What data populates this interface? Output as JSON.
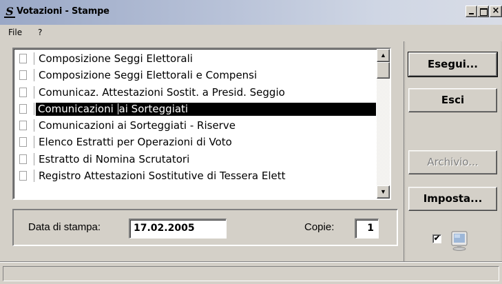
{
  "window": {
    "title": "Votazioni - Stampe",
    "icon": "S-app-icon",
    "controls": {
      "minimize": "_",
      "maximize": "□",
      "close": "×"
    }
  },
  "menu": [
    {
      "label": "File"
    },
    {
      "label": "?"
    }
  ],
  "report_list": {
    "items": [
      {
        "label": "Composizione Seggi Elettorali",
        "checked": false
      },
      {
        "label": "Composizione Seggi Elettorali e Compensi",
        "checked": false
      },
      {
        "label": "Comunicaz. Attestazioni Sostit. a Presid. Seggio",
        "checked": false
      },
      {
        "label_before_caret": "Comunicazioni ",
        "label_after_caret": "ai Sorteggiati",
        "checked": false,
        "selected": true
      },
      {
        "label": "Comunicazioni ai Sorteggiati - Riserve",
        "checked": false
      },
      {
        "label": "Elenco Estratti per Operazioni di Voto",
        "checked": false
      },
      {
        "label": "Estratto di Nomina Scrutatori",
        "checked": false
      },
      {
        "label": "Registro Attestazioni Sostitutive di Tessera Elett",
        "checked": false
      }
    ],
    "scroll": {
      "up": "▲",
      "down": "▼"
    }
  },
  "print_options": {
    "date_label": "Data di stampa:",
    "date_value": "17.02.2005",
    "copies_label": "Copie:",
    "copies_value": "1"
  },
  "buttons": {
    "esegui": "Esegui...",
    "esci": "Esci",
    "archivio": "Archivio...",
    "imposta": "Imposta..."
  },
  "preview_toggle": {
    "checked": true,
    "mark": "✔",
    "icon": "monitor-icon"
  },
  "status": {
    "text": ""
  }
}
